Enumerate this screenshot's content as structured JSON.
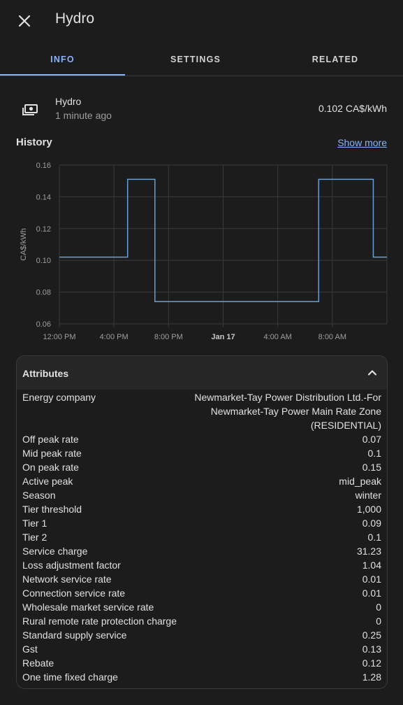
{
  "dialog": {
    "title": "Hydro"
  },
  "tabs": [
    {
      "label": "INFO",
      "active": true
    },
    {
      "label": "SETTINGS",
      "active": false
    },
    {
      "label": "RELATED",
      "active": false
    }
  ],
  "entity": {
    "name": "Hydro",
    "last_changed": "1 minute ago",
    "state": "0.102 CA$/kWh",
    "icon": "cash-icon"
  },
  "history": {
    "title": "History",
    "show_more": "Show more"
  },
  "chart_data": {
    "type": "line",
    "step": true,
    "ylabel": "CA$/kWh",
    "ylim": [
      0.06,
      0.16
    ],
    "y_ticks": [
      "0.06",
      "0.08",
      "0.10",
      "0.12",
      "0.14",
      "0.16"
    ],
    "x_ticks": [
      "12:00 PM",
      "4:00 PM",
      "8:00 PM",
      "Jan 17",
      "4:00 AM",
      "8:00 AM"
    ],
    "x_tick_hours": [
      0,
      4,
      8,
      12,
      16,
      20
    ],
    "bold_ticks": [
      "Jan 17"
    ],
    "xlim_hours": [
      0,
      24
    ],
    "grid": true,
    "series": [
      {
        "color": "#6a9fd4",
        "x_hours": [
          0,
          5,
          5,
          7,
          7,
          19,
          19,
          23,
          23,
          24
        ],
        "values": [
          0.102,
          0.102,
          0.151,
          0.151,
          0.074,
          0.074,
          0.151,
          0.151,
          0.102,
          0.102
        ]
      }
    ]
  },
  "attributes": {
    "title": "Attributes",
    "rows": [
      {
        "label": "Energy company",
        "value": "Newmarket-Tay Power Distribution Ltd.-For Newmarket-Tay Power Main Rate Zone (RESIDENTIAL)"
      },
      {
        "label": "Off peak rate",
        "value": "0.07"
      },
      {
        "label": "Mid peak rate",
        "value": "0.1"
      },
      {
        "label": "On peak rate",
        "value": "0.15"
      },
      {
        "label": "Active peak",
        "value": "mid_peak"
      },
      {
        "label": "Season",
        "value": "winter"
      },
      {
        "label": "Tier threshold",
        "value": "1,000"
      },
      {
        "label": "Tier 1",
        "value": "0.09"
      },
      {
        "label": "Tier 2",
        "value": "0.1"
      },
      {
        "label": "Service charge",
        "value": "31.23"
      },
      {
        "label": "Loss adjustment factor",
        "value": "1.04"
      },
      {
        "label": "Network service rate",
        "value": "0.01"
      },
      {
        "label": "Connection service rate",
        "value": "0.01"
      },
      {
        "label": "Wholesale market service rate",
        "value": "0"
      },
      {
        "label": "Rural remote rate protection charge",
        "value": "0"
      },
      {
        "label": "Standard supply service",
        "value": "0.25"
      },
      {
        "label": "Gst",
        "value": "0.13"
      },
      {
        "label": "Rebate",
        "value": "0.12"
      },
      {
        "label": "One time fixed charge",
        "value": "1.28"
      }
    ]
  }
}
